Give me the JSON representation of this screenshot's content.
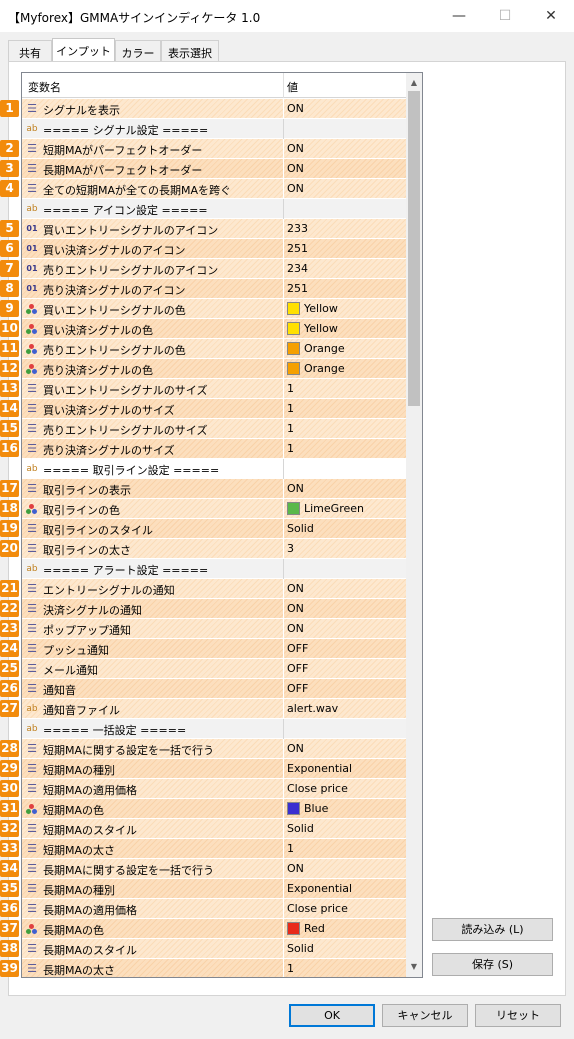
{
  "window": {
    "title": "【Myforex】GMMAサインインディケータ 1.0",
    "minimize": "—",
    "maximize": "☐",
    "close": "✕"
  },
  "tabs": [
    {
      "label": "共有"
    },
    {
      "label": "インプット"
    },
    {
      "label": "カラー"
    },
    {
      "label": "表示選択"
    }
  ],
  "grid": {
    "col_name": "変数名",
    "col_value": "値",
    "rows": [
      {
        "badge": "1",
        "icon": "eq",
        "name": "シグナルを表示",
        "value": "ON"
      },
      {
        "badge": "",
        "icon": "ab",
        "name": "===== シグナル設定 =====",
        "value": "",
        "section": true
      },
      {
        "badge": "2",
        "icon": "eq",
        "name": "短期MAがパーフェクトオーダー",
        "value": "ON"
      },
      {
        "badge": "3",
        "icon": "eq",
        "name": "長期MAがパーフェクトオーダー",
        "value": "ON"
      },
      {
        "badge": "4",
        "icon": "eq",
        "name": "全ての短期MAが全ての長期MAを跨ぐ",
        "value": "ON"
      },
      {
        "badge": "",
        "icon": "ab",
        "name": "===== アイコン設定 =====",
        "value": "",
        "section": true
      },
      {
        "badge": "5",
        "icon": "num",
        "name": "買いエントリーシグナルのアイコン",
        "value": "233"
      },
      {
        "badge": "6",
        "icon": "num",
        "name": "買い決済シグナルのアイコン",
        "value": "251"
      },
      {
        "badge": "7",
        "icon": "num",
        "name": "売りエントリーシグナルのアイコン",
        "value": "234"
      },
      {
        "badge": "8",
        "icon": "num",
        "name": "売り決済シグナルのアイコン",
        "value": "251"
      },
      {
        "badge": "9",
        "icon": "color",
        "name": "買いエントリーシグナルの色",
        "value": "Yellow",
        "swatch": "#ffe000"
      },
      {
        "badge": "10",
        "icon": "color",
        "name": "買い決済シグナルの色",
        "value": "Yellow",
        "swatch": "#ffe000"
      },
      {
        "badge": "11",
        "icon": "color",
        "name": "売りエントリーシグナルの色",
        "value": "Orange",
        "swatch": "#f5a000"
      },
      {
        "badge": "12",
        "icon": "color",
        "name": "売り決済シグナルの色",
        "value": "Orange",
        "swatch": "#f5a000"
      },
      {
        "badge": "13",
        "icon": "eq",
        "name": "買いエントリーシグナルのサイズ",
        "value": "1"
      },
      {
        "badge": "14",
        "icon": "eq",
        "name": "買い決済シグナルのサイズ",
        "value": "1"
      },
      {
        "badge": "15",
        "icon": "eq",
        "name": "売りエントリーシグナルのサイズ",
        "value": "1"
      },
      {
        "badge": "16",
        "icon": "eq",
        "name": "売り決済シグナルのサイズ",
        "value": "1"
      },
      {
        "badge": "",
        "icon": "ab",
        "name": "===== 取引ライン設定 =====",
        "value": "",
        "section": true,
        "white": true
      },
      {
        "badge": "17",
        "icon": "eq",
        "name": "取引ラインの表示",
        "value": "ON"
      },
      {
        "badge": "18",
        "icon": "color",
        "name": "取引ラインの色",
        "value": "LimeGreen",
        "swatch": "#5ab84a"
      },
      {
        "badge": "19",
        "icon": "eq",
        "name": "取引ラインのスタイル",
        "value": "Solid"
      },
      {
        "badge": "20",
        "icon": "eq",
        "name": "取引ラインの太さ",
        "value": "3"
      },
      {
        "badge": "",
        "icon": "ab",
        "name": "===== アラート設定 =====",
        "value": "",
        "section": true
      },
      {
        "badge": "21",
        "icon": "eq",
        "name": "エントリーシグナルの通知",
        "value": "ON"
      },
      {
        "badge": "22",
        "icon": "eq",
        "name": "決済シグナルの通知",
        "value": "ON"
      },
      {
        "badge": "23",
        "icon": "eq",
        "name": "ポップアップ通知",
        "value": "ON"
      },
      {
        "badge": "24",
        "icon": "eq",
        "name": "プッシュ通知",
        "value": "OFF"
      },
      {
        "badge": "25",
        "icon": "eq",
        "name": "メール通知",
        "value": "OFF"
      },
      {
        "badge": "26",
        "icon": "eq",
        "name": "通知音",
        "value": "OFF"
      },
      {
        "badge": "27",
        "icon": "ab",
        "name": "通知音ファイル",
        "value": "alert.wav"
      },
      {
        "badge": "",
        "icon": "ab",
        "name": "===== 一括設定 =====",
        "value": "",
        "section": true
      },
      {
        "badge": "28",
        "icon": "eq",
        "name": "短期MAに関する設定を一括で行う",
        "value": "ON"
      },
      {
        "badge": "29",
        "icon": "eq",
        "name": "短期MAの種別",
        "value": "Exponential"
      },
      {
        "badge": "30",
        "icon": "eq",
        "name": "短期MAの適用価格",
        "value": "Close price"
      },
      {
        "badge": "31",
        "icon": "color",
        "name": "短期MAの色",
        "value": "Blue",
        "swatch": "#3a2fd0"
      },
      {
        "badge": "32",
        "icon": "eq",
        "name": "短期MAのスタイル",
        "value": "Solid"
      },
      {
        "badge": "33",
        "icon": "eq",
        "name": "短期MAの太さ",
        "value": "1"
      },
      {
        "badge": "34",
        "icon": "eq",
        "name": "長期MAに関する設定を一括で行う",
        "value": "ON"
      },
      {
        "badge": "35",
        "icon": "eq",
        "name": "長期MAの種別",
        "value": "Exponential"
      },
      {
        "badge": "36",
        "icon": "eq",
        "name": "長期MAの適用価格",
        "value": "Close price"
      },
      {
        "badge": "37",
        "icon": "color",
        "name": "長期MAの色",
        "value": "Red",
        "swatch": "#e82a1a"
      },
      {
        "badge": "38",
        "icon": "eq",
        "name": "長期MAのスタイル",
        "value": "Solid"
      },
      {
        "badge": "39",
        "icon": "eq",
        "name": "長期MAの太さ",
        "value": "1"
      }
    ]
  },
  "side_buttons": {
    "load": "読み込み (L)",
    "save": "保存 (S)"
  },
  "footer_buttons": {
    "ok": "OK",
    "cancel": "キャンセル",
    "reset": "リセット"
  }
}
